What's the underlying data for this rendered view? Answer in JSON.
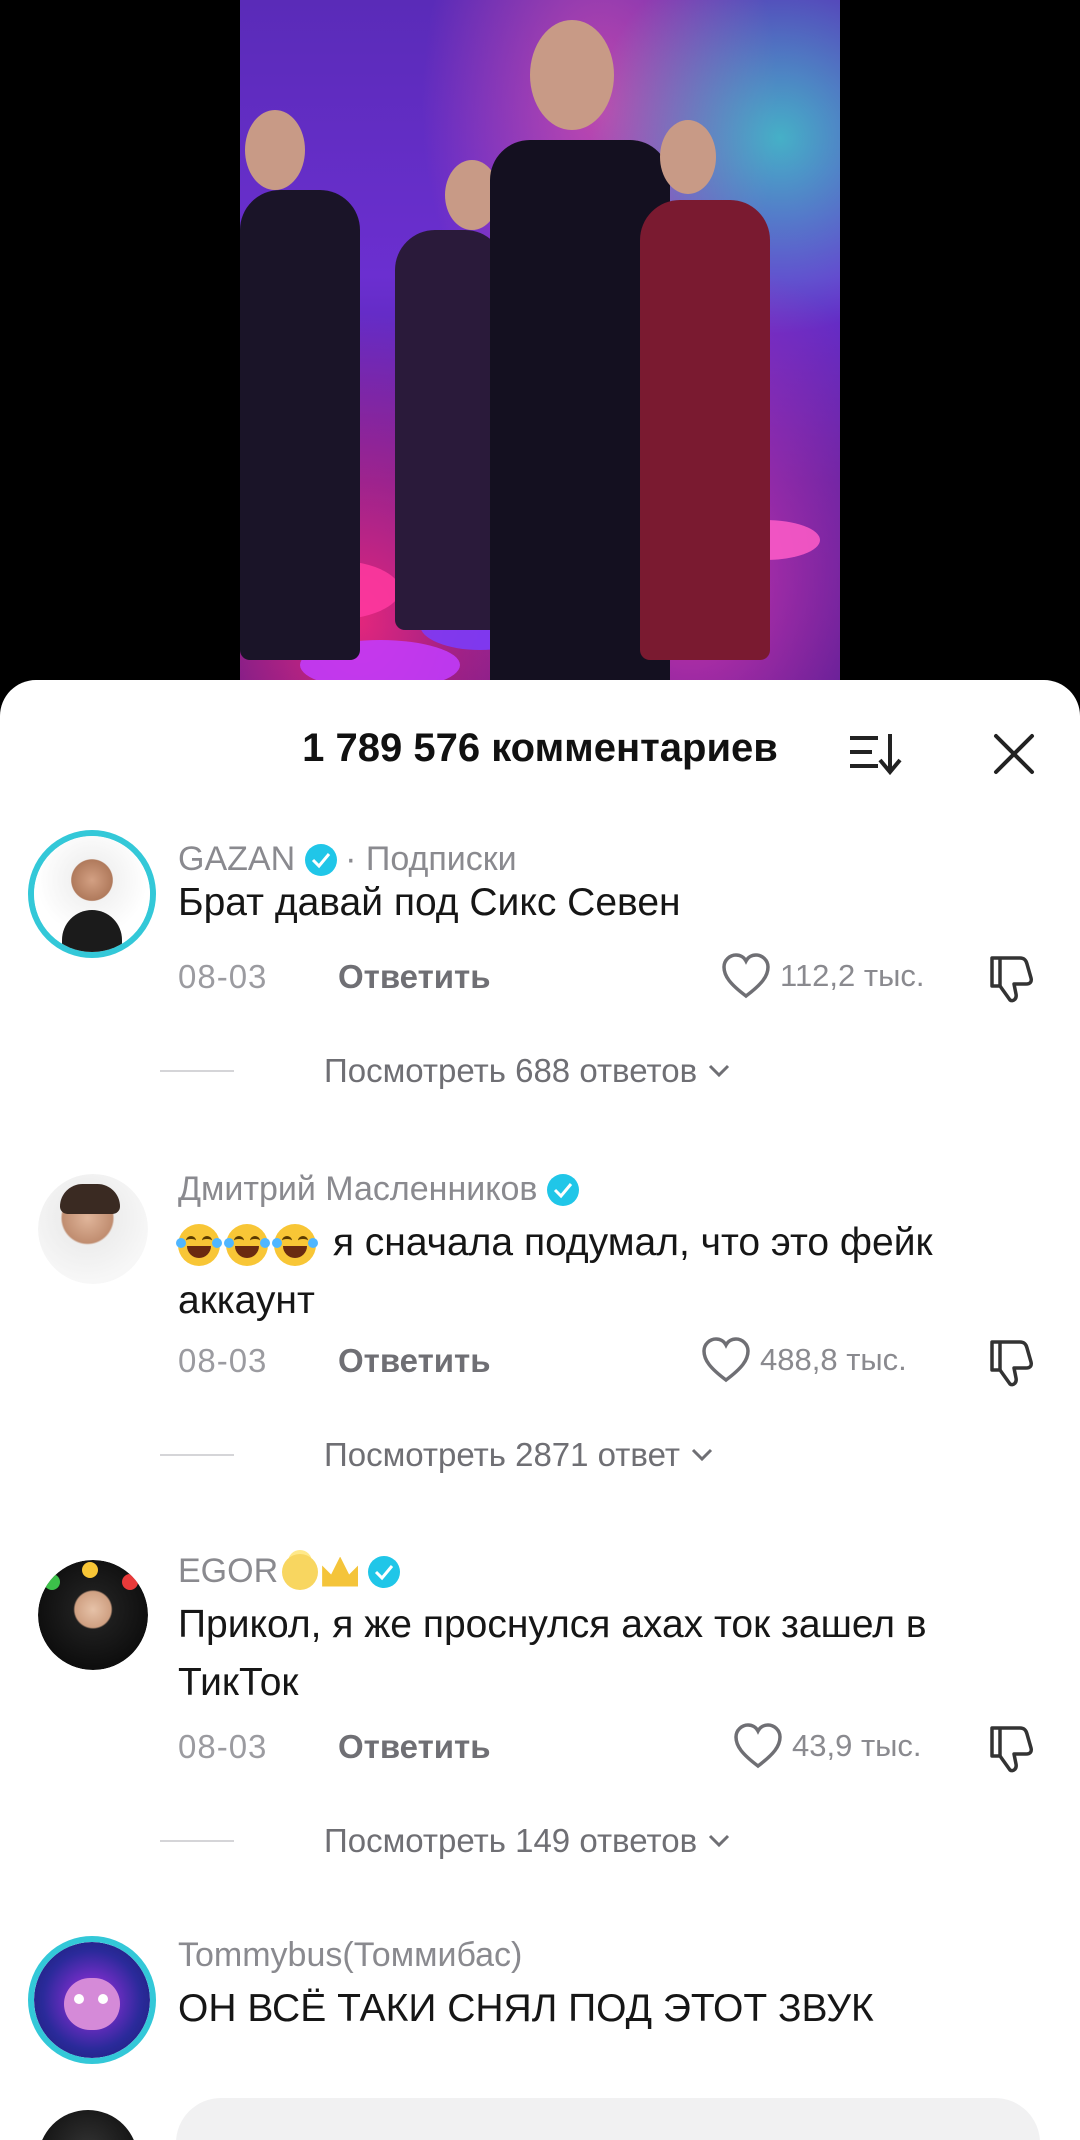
{
  "comments_sheet": {
    "title": "1 789 576 комментариев"
  },
  "comments": [
    {
      "username": "GAZAN",
      "verified": true,
      "suffix": "· Подписки",
      "text": "Брат давай под Сикс Севен",
      "date": "08-03",
      "reply_label": "Ответить",
      "likes": "112,2 тыс.",
      "view_replies": "Посмотреть 688 ответов"
    },
    {
      "username": "Дмитрий Масленников",
      "verified": true,
      "text_emoji_count": 3,
      "text": "я сначала подумал, что это фейк аккаунт",
      "date": "08-03",
      "reply_label": "Ответить",
      "likes": "488,8 тыс.",
      "view_replies": "Посмотреть 2871 ответ"
    },
    {
      "username": "EGOR",
      "verified": true,
      "text": "Прикол, я же проснулся ахах ток зашел в ТикТок",
      "date": "08-03",
      "reply_label": "Ответить",
      "likes": "43,9 тыс.",
      "view_replies": "Посмотреть 149 ответов"
    },
    {
      "username": "Tommybus(Томмибас)",
      "verified": false,
      "text": "ОН ВСЁ ТАКИ СНЯЛ ПОД ЭТОТ ЗВУК"
    }
  ],
  "colors": {
    "accent_ring": "#33c8d8",
    "verified": "#20c6e8",
    "text_primary": "#161616",
    "text_secondary": "#8a8a8f"
  },
  "icons": [
    "sort-icon",
    "close-icon",
    "heart-icon",
    "dislike-icon",
    "verified-icon",
    "chevron-down-icon"
  ]
}
